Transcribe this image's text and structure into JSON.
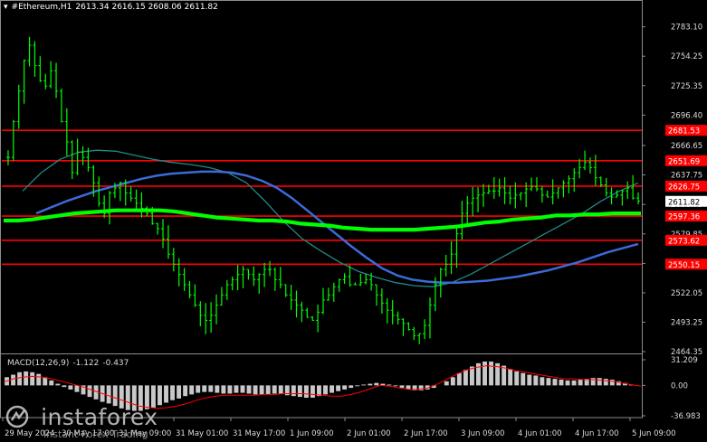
{
  "header": {
    "symbol": "#Ethereum,H1",
    "ohlc": "2613.34 2616.15 2608.06 2611.82"
  },
  "watermark": {
    "name": "instaforex",
    "tagline": "Instant Forex Trading"
  },
  "colors": {
    "background": "#000000",
    "candles": "#00ff00",
    "levels": "#ff0000",
    "ma_fast": "#00ff00",
    "ma_mid": "#3b6bd8",
    "ma_slow": "#1f8a8a",
    "macd_hist": "#c8c8c8",
    "macd_signal": "#ff0000",
    "axis": "#8c8c8c",
    "current_price_box": "#ffffff"
  },
  "chart_data": [
    {
      "type": "candlestick",
      "timeframe": "H1",
      "ylim": [
        2464.35,
        2797.0
      ],
      "y_tick_labels": [
        "2783.10",
        "2754.25",
        "2725.35",
        "2696.40",
        "2666.65",
        "2637.75",
        "2608.75",
        "2579.85",
        "2550.95",
        "2522.05",
        "2493.25",
        "2464.35"
      ],
      "x_tick_labels": [
        "29 May 2024",
        "30 May 17:00",
        "31 May 09:00",
        "31 May 01:00",
        "31 May 17:00",
        "1 Jun 09:00",
        "2 Jun 01:00",
        "2 Jun 17:00",
        "3 Jun 09:00",
        "4 Jun 01:00",
        "4 Jun 17:00",
        "5 Jun 09:00"
      ],
      "current_price": "2611.82",
      "levels": [
        {
          "label": "2681.53",
          "value": 2681.53
        },
        {
          "label": "2651.69",
          "value": 2651.69
        },
        {
          "label": "2626.75",
          "value": 2626.75
        },
        {
          "label": "2597.36",
          "value": 2597.36
        },
        {
          "label": "2573.62",
          "value": 2573.62
        },
        {
          "label": "2550.15",
          "value": 2550.15
        }
      ],
      "close_path": [
        2655,
        2690,
        2720,
        2750,
        2765,
        2745,
        2730,
        2725,
        2740,
        2720,
        2690,
        2670,
        2640,
        2660,
        2655,
        2645,
        2630,
        2610,
        2600,
        2620,
        2625,
        2630,
        2620,
        2615,
        2610,
        2605,
        2600,
        2590,
        2585,
        2575,
        2560,
        2550,
        2540,
        2530,
        2520,
        2510,
        2500,
        2495,
        2500,
        2510,
        2520,
        2530,
        2535,
        2540,
        2545,
        2540,
        2535,
        2540,
        2545,
        2545,
        2535,
        2530,
        2520,
        2515,
        2510,
        2505,
        2498,
        2495,
        2503,
        2515,
        2520,
        2528,
        2535,
        2538,
        2530,
        2530,
        2532,
        2535,
        2530,
        2520,
        2512,
        2505,
        2500,
        2496,
        2492,
        2486,
        2480,
        2482,
        2490,
        2510,
        2530,
        2545,
        2550,
        2560,
        2580,
        2600,
        2610,
        2615,
        2618,
        2620,
        2622,
        2622,
        2625,
        2620,
        2615,
        2618,
        2620,
        2624,
        2626,
        2624,
        2618,
        2616,
        2620,
        2625,
        2630,
        2634,
        2640,
        2645,
        2650,
        2645,
        2635,
        2628,
        2620,
        2616,
        2618,
        2622,
        2625,
        2615,
        2612
      ],
      "ma_fast_path": [
        2593,
        2593,
        2594,
        2596,
        2598,
        2600,
        2601,
        2602,
        2603,
        2603,
        2603,
        2603,
        2602,
        2600,
        2598,
        2596,
        2595,
        2594,
        2593,
        2593,
        2592,
        2590,
        2589,
        2588,
        2586,
        2585,
        2584,
        2584,
        2584,
        2584,
        2585,
        2586,
        2587,
        2589,
        2591,
        2592,
        2594,
        2595,
        2596,
        2598,
        2598,
        2599,
        2599,
        2600,
        2600,
        2600
      ],
      "ma_mid_path": [
        2600,
        2606,
        2612,
        2617,
        2622,
        2626,
        2630,
        2634,
        2637,
        2639,
        2640,
        2641,
        2641,
        2640,
        2637,
        2632,
        2625,
        2615,
        2603,
        2591,
        2579,
        2567,
        2556,
        2546,
        2539,
        2535,
        2533,
        2532,
        2532,
        2533,
        2534,
        2536,
        2538,
        2541,
        2544,
        2548,
        2552,
        2557,
        2562,
        2566,
        2570
      ],
      "ma_slow_path": [
        2622,
        2640,
        2653,
        2660,
        2662,
        2661,
        2657,
        2653,
        2650,
        2648,
        2645,
        2640,
        2630,
        2612,
        2592,
        2575,
        2563,
        2552,
        2543,
        2537,
        2532,
        2529,
        2528,
        2532,
        2540,
        2550,
        2560,
        2570,
        2580,
        2590,
        2600,
        2612,
        2622,
        2630
      ]
    },
    {
      "type": "bar",
      "name": "MACD(12,26,9)",
      "values_text": [
        "-1.122",
        "-0.437"
      ],
      "y_tick_labels": [
        "31.209",
        "0.00",
        "-36.983"
      ],
      "ylim": [
        -36.983,
        31.209
      ],
      "histogram": [
        10,
        13,
        16,
        17,
        16,
        14,
        10,
        6,
        2,
        -2,
        -5,
        -8,
        -11,
        -14,
        -17,
        -20,
        -22,
        -25,
        -28,
        -30,
        -31,
        -31,
        -29,
        -27,
        -24,
        -21,
        -18,
        -16,
        -13,
        -11,
        -9,
        -8,
        -8,
        -9,
        -10,
        -10,
        -9,
        -9,
        -10,
        -11,
        -11,
        -11,
        -10,
        -10,
        -12,
        -13,
        -14,
        -15,
        -15,
        -13,
        -11,
        -9,
        -7,
        -5,
        -3,
        -1,
        1,
        2,
        3,
        2,
        1,
        -1,
        -3,
        -5,
        -6,
        -6,
        -5,
        -3,
        0,
        5,
        10,
        15,
        19,
        23,
        27,
        29,
        29,
        27,
        24,
        20,
        17,
        15,
        13,
        12,
        10,
        9,
        8,
        7,
        6,
        6,
        7,
        8,
        9,
        9,
        8,
        7,
        5,
        3,
        1,
        0
      ],
      "signal": [
        4,
        8,
        10,
        11,
        10,
        8,
        5,
        2,
        -1,
        -5,
        -9,
        -13,
        -17,
        -21,
        -25,
        -27,
        -28,
        -27,
        -25,
        -22,
        -18,
        -15,
        -13,
        -12,
        -12,
        -12,
        -12,
        -11,
        -11,
        -10,
        -10,
        -10,
        -11,
        -12,
        -13,
        -13,
        -11,
        -8,
        -4,
        0,
        -1,
        -3,
        -5,
        -5,
        -3,
        2,
        8,
        14,
        19,
        22,
        24,
        23,
        21,
        18,
        16,
        14,
        12,
        10,
        8,
        8,
        7,
        7,
        6,
        5,
        3,
        1,
        -1
      ]
    }
  ]
}
